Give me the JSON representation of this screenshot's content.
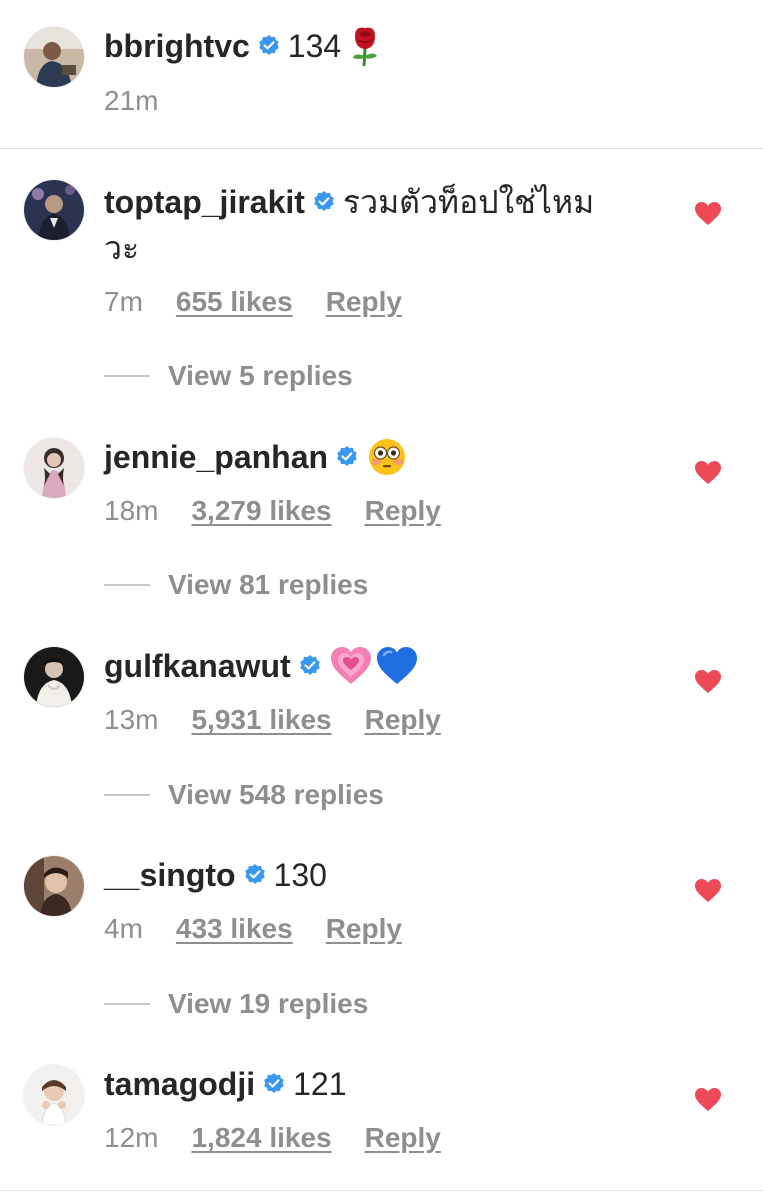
{
  "caption": {
    "username": "bbrightvc",
    "text": "134",
    "emoji": "rose-emoji",
    "time": "21m"
  },
  "comments": [
    {
      "username": "toptap_jirakit",
      "text": "รวมตัวท็อปใช่ไหม",
      "text_cont": "วะ",
      "time": "7m",
      "likes": "655 likes",
      "reply": "Reply",
      "view_replies": "View 5 replies",
      "liked": true
    },
    {
      "username": "jennie_panhan",
      "text": "",
      "emoji": "flushed-face-emoji",
      "time": "18m",
      "likes": "3,279 likes",
      "reply": "Reply",
      "view_replies": "View 81 replies",
      "liked": true
    },
    {
      "username": "gulfkanawut",
      "text": "",
      "emoji": "growing-heart-and-blue-heart-emoji",
      "time": "13m",
      "likes": "5,931 likes",
      "reply": "Reply",
      "view_replies": "View 548 replies",
      "liked": true
    },
    {
      "username": "__singto",
      "text": "130",
      "time": "4m",
      "likes": "433 likes",
      "reply": "Reply",
      "view_replies": "View 19 replies",
      "liked": true
    },
    {
      "username": "tamagodji",
      "text": "121",
      "time": "12m",
      "likes": "1,824 likes",
      "reply": "Reply",
      "liked": true
    }
  ],
  "colors": {
    "verified": "#3897f0",
    "heart": "#ed4956",
    "secondary_text": "#8e8e8e",
    "primary_text": "#262626"
  }
}
